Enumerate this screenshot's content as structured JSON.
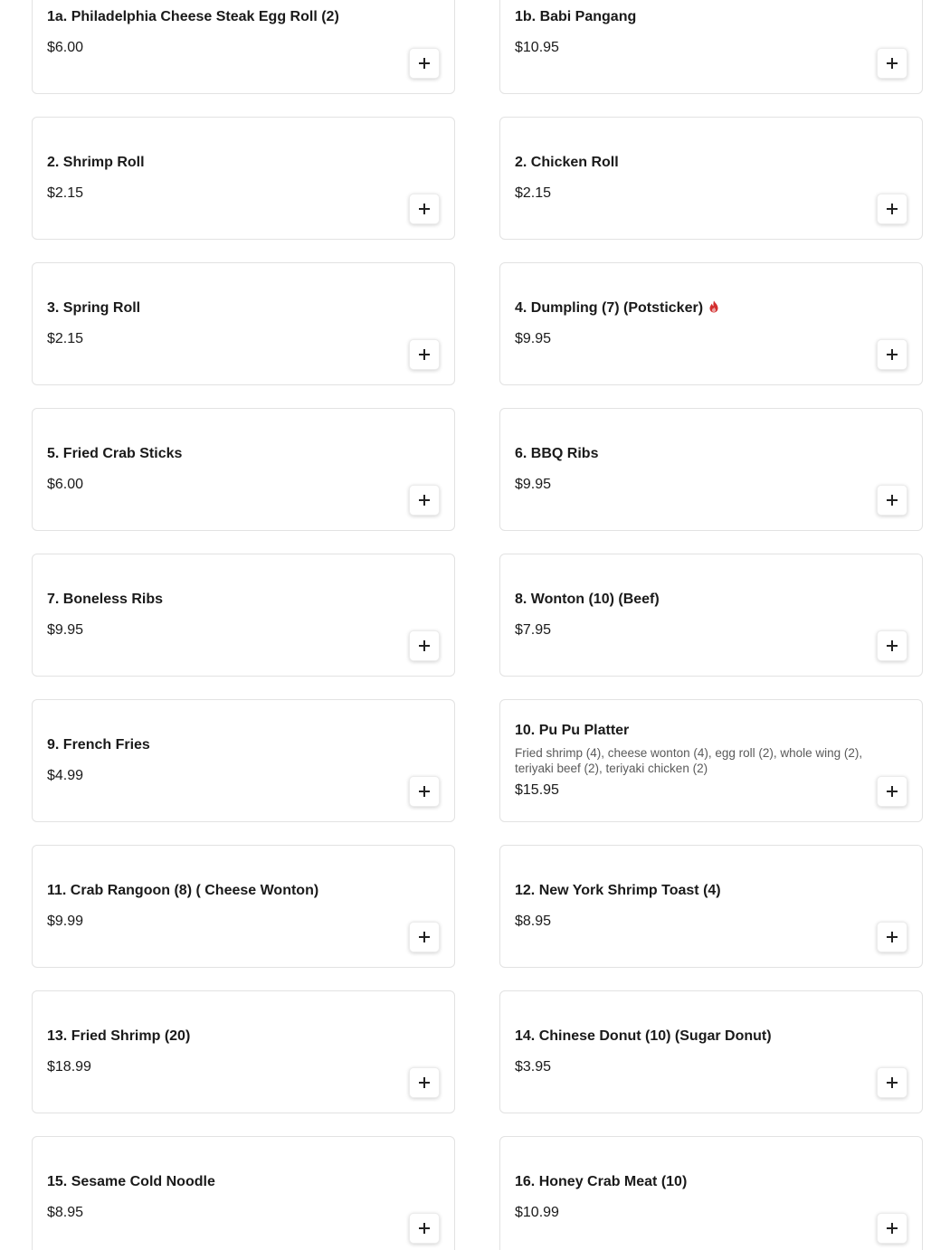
{
  "accent_color": "#d32f2f",
  "menu": {
    "items": [
      {
        "name": "1a. Philadelphia Cheese Steak Egg Roll (2)",
        "price": "$6.00",
        "description": "",
        "spicy": false
      },
      {
        "name": "1b. Babi Pangang",
        "price": "$10.95",
        "description": "",
        "spicy": false
      },
      {
        "name": "2. Shrimp Roll",
        "price": "$2.15",
        "description": "",
        "spicy": false
      },
      {
        "name": "2. Chicken Roll",
        "price": "$2.15",
        "description": "",
        "spicy": false
      },
      {
        "name": "3. Spring Roll",
        "price": "$2.15",
        "description": "",
        "spicy": false
      },
      {
        "name": "4. Dumpling (7) (Potsticker)",
        "price": "$9.95",
        "description": "",
        "spicy": true,
        "spicy_icon": "flame-icon"
      },
      {
        "name": "5. Fried Crab Sticks",
        "price": "$6.00",
        "description": "",
        "spicy": false
      },
      {
        "name": "6. BBQ Ribs",
        "price": "$9.95",
        "description": "",
        "spicy": false
      },
      {
        "name": "7. Boneless Ribs",
        "price": "$9.95",
        "description": "",
        "spicy": false
      },
      {
        "name": "8. Wonton (10) (Beef)",
        "price": "$7.95",
        "description": "",
        "spicy": false
      },
      {
        "name": "9. French Fries",
        "price": "$4.99",
        "description": "",
        "spicy": false
      },
      {
        "name": "10. Pu Pu Platter",
        "price": "$15.95",
        "description": "Fried shrimp (4), cheese wonton (4), egg roll (2), whole wing (2), teriyaki beef (2), teriyaki chicken (2)",
        "spicy": false
      },
      {
        "name": "11. Crab Rangoon (8) ( Cheese Wonton)",
        "price": "$9.99",
        "description": "",
        "spicy": false
      },
      {
        "name": "12. New York Shrimp Toast (4)",
        "price": "$8.95",
        "description": "",
        "spicy": false
      },
      {
        "name": "13. Fried Shrimp (20)",
        "price": "$18.99",
        "description": "",
        "spicy": false
      },
      {
        "name": "14. Chinese Donut (10) (Sugar Donut)",
        "price": "$3.95",
        "description": "",
        "spicy": false
      },
      {
        "name": "15. Sesame Cold Noodle",
        "price": "$8.95",
        "description": "",
        "spicy": false
      },
      {
        "name": "16. Honey Crab Meat (10)",
        "price": "$10.99",
        "description": "",
        "spicy": false
      }
    ],
    "add_button_icon": "plus-icon"
  }
}
